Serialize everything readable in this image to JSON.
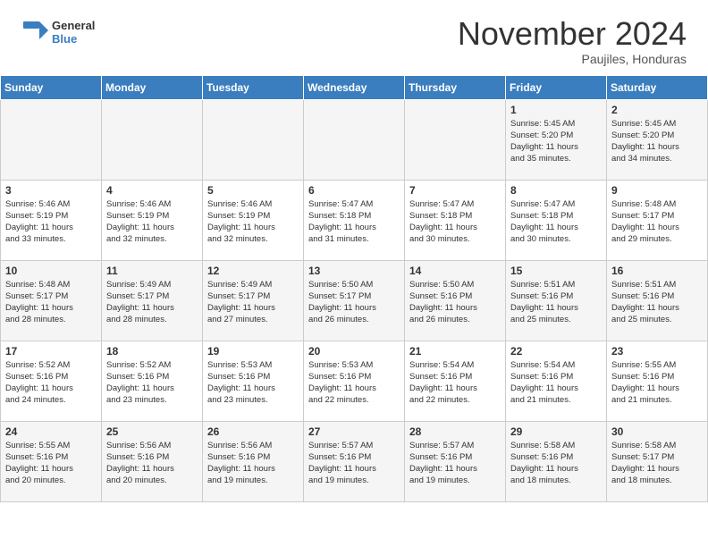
{
  "header": {
    "logo_general": "General",
    "logo_blue": "Blue",
    "month": "November 2024",
    "location": "Paujiles, Honduras"
  },
  "days_of_week": [
    "Sunday",
    "Monday",
    "Tuesday",
    "Wednesday",
    "Thursday",
    "Friday",
    "Saturday"
  ],
  "weeks": [
    [
      {
        "day": "",
        "text": ""
      },
      {
        "day": "",
        "text": ""
      },
      {
        "day": "",
        "text": ""
      },
      {
        "day": "",
        "text": ""
      },
      {
        "day": "",
        "text": ""
      },
      {
        "day": "1",
        "text": "Sunrise: 5:45 AM\nSunset: 5:20 PM\nDaylight: 11 hours\nand 35 minutes."
      },
      {
        "day": "2",
        "text": "Sunrise: 5:45 AM\nSunset: 5:20 PM\nDaylight: 11 hours\nand 34 minutes."
      }
    ],
    [
      {
        "day": "3",
        "text": "Sunrise: 5:46 AM\nSunset: 5:19 PM\nDaylight: 11 hours\nand 33 minutes."
      },
      {
        "day": "4",
        "text": "Sunrise: 5:46 AM\nSunset: 5:19 PM\nDaylight: 11 hours\nand 32 minutes."
      },
      {
        "day": "5",
        "text": "Sunrise: 5:46 AM\nSunset: 5:19 PM\nDaylight: 11 hours\nand 32 minutes."
      },
      {
        "day": "6",
        "text": "Sunrise: 5:47 AM\nSunset: 5:18 PM\nDaylight: 11 hours\nand 31 minutes."
      },
      {
        "day": "7",
        "text": "Sunrise: 5:47 AM\nSunset: 5:18 PM\nDaylight: 11 hours\nand 30 minutes."
      },
      {
        "day": "8",
        "text": "Sunrise: 5:47 AM\nSunset: 5:18 PM\nDaylight: 11 hours\nand 30 minutes."
      },
      {
        "day": "9",
        "text": "Sunrise: 5:48 AM\nSunset: 5:17 PM\nDaylight: 11 hours\nand 29 minutes."
      }
    ],
    [
      {
        "day": "10",
        "text": "Sunrise: 5:48 AM\nSunset: 5:17 PM\nDaylight: 11 hours\nand 28 minutes."
      },
      {
        "day": "11",
        "text": "Sunrise: 5:49 AM\nSunset: 5:17 PM\nDaylight: 11 hours\nand 28 minutes."
      },
      {
        "day": "12",
        "text": "Sunrise: 5:49 AM\nSunset: 5:17 PM\nDaylight: 11 hours\nand 27 minutes."
      },
      {
        "day": "13",
        "text": "Sunrise: 5:50 AM\nSunset: 5:17 PM\nDaylight: 11 hours\nand 26 minutes."
      },
      {
        "day": "14",
        "text": "Sunrise: 5:50 AM\nSunset: 5:16 PM\nDaylight: 11 hours\nand 26 minutes."
      },
      {
        "day": "15",
        "text": "Sunrise: 5:51 AM\nSunset: 5:16 PM\nDaylight: 11 hours\nand 25 minutes."
      },
      {
        "day": "16",
        "text": "Sunrise: 5:51 AM\nSunset: 5:16 PM\nDaylight: 11 hours\nand 25 minutes."
      }
    ],
    [
      {
        "day": "17",
        "text": "Sunrise: 5:52 AM\nSunset: 5:16 PM\nDaylight: 11 hours\nand 24 minutes."
      },
      {
        "day": "18",
        "text": "Sunrise: 5:52 AM\nSunset: 5:16 PM\nDaylight: 11 hours\nand 23 minutes."
      },
      {
        "day": "19",
        "text": "Sunrise: 5:53 AM\nSunset: 5:16 PM\nDaylight: 11 hours\nand 23 minutes."
      },
      {
        "day": "20",
        "text": "Sunrise: 5:53 AM\nSunset: 5:16 PM\nDaylight: 11 hours\nand 22 minutes."
      },
      {
        "day": "21",
        "text": "Sunrise: 5:54 AM\nSunset: 5:16 PM\nDaylight: 11 hours\nand 22 minutes."
      },
      {
        "day": "22",
        "text": "Sunrise: 5:54 AM\nSunset: 5:16 PM\nDaylight: 11 hours\nand 21 minutes."
      },
      {
        "day": "23",
        "text": "Sunrise: 5:55 AM\nSunset: 5:16 PM\nDaylight: 11 hours\nand 21 minutes."
      }
    ],
    [
      {
        "day": "24",
        "text": "Sunrise: 5:55 AM\nSunset: 5:16 PM\nDaylight: 11 hours\nand 20 minutes."
      },
      {
        "day": "25",
        "text": "Sunrise: 5:56 AM\nSunset: 5:16 PM\nDaylight: 11 hours\nand 20 minutes."
      },
      {
        "day": "26",
        "text": "Sunrise: 5:56 AM\nSunset: 5:16 PM\nDaylight: 11 hours\nand 19 minutes."
      },
      {
        "day": "27",
        "text": "Sunrise: 5:57 AM\nSunset: 5:16 PM\nDaylight: 11 hours\nand 19 minutes."
      },
      {
        "day": "28",
        "text": "Sunrise: 5:57 AM\nSunset: 5:16 PM\nDaylight: 11 hours\nand 19 minutes."
      },
      {
        "day": "29",
        "text": "Sunrise: 5:58 AM\nSunset: 5:16 PM\nDaylight: 11 hours\nand 18 minutes."
      },
      {
        "day": "30",
        "text": "Sunrise: 5:58 AM\nSunset: 5:17 PM\nDaylight: 11 hours\nand 18 minutes."
      }
    ]
  ]
}
